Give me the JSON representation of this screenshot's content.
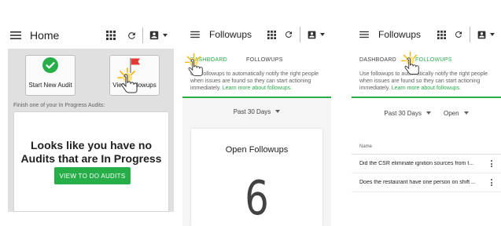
{
  "colors": {
    "accent": "#27ae49",
    "flag": "#e53935",
    "background": "#e0e0e0"
  },
  "icons": [
    "hamburger-icon",
    "grid-icon",
    "refresh-icon",
    "account-icon",
    "chevron-down-icon",
    "check-circle-icon",
    "flag-icon",
    "pointer-hand-icon",
    "kebab-icon"
  ],
  "home": {
    "title": "Home",
    "start_audit_label": "Start New Audit",
    "view_followups_label": "View Followups",
    "in_progress_hint": "Finish one of your In Progress Audits:",
    "empty_message": "Looks like you have no Audits that are In Progress",
    "view_audits_button": "VIEW TO DO AUDITS"
  },
  "followups_dashboard": {
    "title": "Followups",
    "tabs": [
      {
        "label": "DASHBOARD"
      },
      {
        "label": "FOLLOWUPS"
      }
    ],
    "info_text": "Use followups to automatically notify the right people when issues are found so they can start actioning immediately.",
    "info_link": "Learn more about followups.",
    "period_filter": "Past 30 Days",
    "card_title": "Open Followups",
    "card_value": "6"
  },
  "followups_list": {
    "title": "Followups",
    "tabs": [
      {
        "label": "DASHBOARD"
      },
      {
        "label": "FOLLOWUPS"
      }
    ],
    "info_text": "Use followups to automatically notify the right people when issues are found so they can start actioning immediately.",
    "info_link": "Learn more about followups.",
    "period_filter": "Past 30 Days",
    "status_filter": "Open",
    "column_name": "Name",
    "rows": [
      {
        "name": "Did the CSR eliminate ignition sources from t..."
      },
      {
        "name": "Does the restaurant have one person on shift ..."
      }
    ]
  }
}
